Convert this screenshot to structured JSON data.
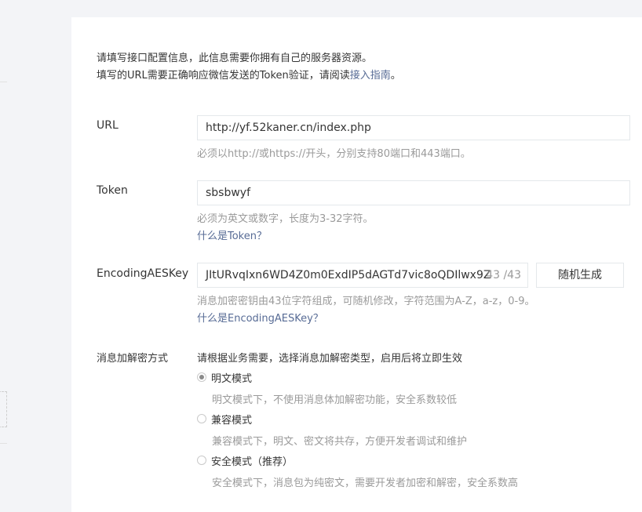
{
  "intro": {
    "line1": "请填写接口配置信息，此信息需要你拥有自己的服务器资源。",
    "line2_prefix": "填写的URL需要正确响应微信发送的Token验证，请阅读",
    "line2_link": "接入指南",
    "line2_suffix": "。"
  },
  "url": {
    "label": "URL",
    "value": "http://yf.52kaner.cn/index.php",
    "tip": "必须以http://或https://开头，分别支持80端口和443端口。"
  },
  "token": {
    "label": "Token",
    "value": "sbsbwyf",
    "tip": "必须为英文或数字，长度为3-32字符。",
    "help_link": "什么是Token？"
  },
  "aeskey": {
    "label": "EncodingAESKey",
    "value": "JItURvqIxn6WD4Z0m0ExdIP5dAGTd7vic8oQDIlwx9Z",
    "counter": "43 /43",
    "random_button": "随机生成",
    "tip": "消息加密密钥由43位字符组成，可随机修改，字符范围为A-Z，a-z，0-9。",
    "help_link": "什么是EncodingAESKey？"
  },
  "encrypt_mode": {
    "label": "消息加解密方式",
    "description": "请根据业务需要，选择消息加解密类型，启用后将立即生效",
    "options": [
      {
        "label": "明文模式",
        "desc": "明文模式下，不使用消息体加解密功能，安全系数较低",
        "checked": true
      },
      {
        "label": "兼容模式",
        "desc": "兼容模式下，明文、密文将共存，方便开发者调试和维护",
        "checked": false
      },
      {
        "label": "安全模式（推荐）",
        "desc": "安全模式下，消息包为纯密文，需要开发者加密和解密，安全系数高",
        "checked": false
      }
    ]
  },
  "colors": {
    "link": "#576b95",
    "muted": "#9a9a9a",
    "text": "#353535",
    "border": "#e4e8eb"
  }
}
